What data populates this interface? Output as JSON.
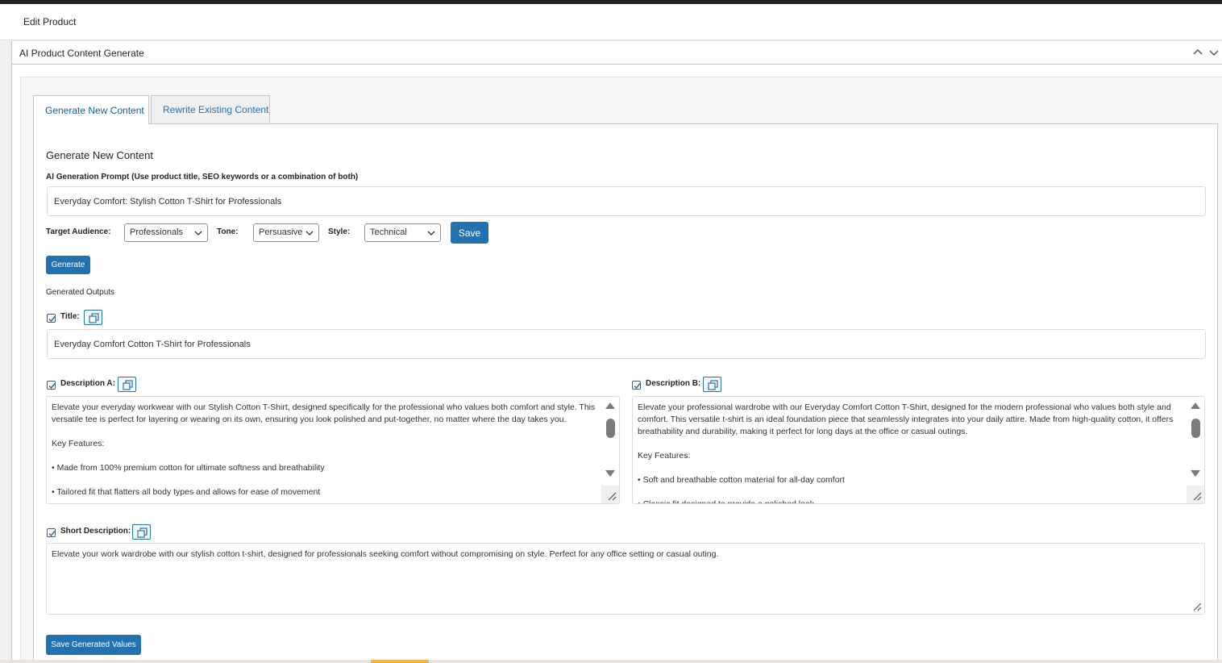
{
  "header": {
    "title": "Edit Product"
  },
  "postbox": {
    "title": "AI Product Content Generate"
  },
  "tabs": [
    {
      "label": "Generate New Content",
      "active": true
    },
    {
      "label": "Rewrite Existing Content",
      "active": false
    }
  ],
  "panel": {
    "heading": "Generate New Content",
    "prompt_label": "AI Generation Prompt (Use product title, SEO keywords or a combination of both)",
    "prompt_value": "Everyday Comfort: Stylish Cotton T-Shirt for Professionals",
    "target_audience_label": "Target Audience:",
    "target_audience_value": "Professionals",
    "tone_label": "Tone:",
    "tone_value": "Persuasive",
    "style_label": "Style:",
    "style_value": "Technical",
    "save_label": "Save",
    "generate_label": "Generate",
    "outputs_label": "Generated Outputs"
  },
  "outputs": {
    "title": {
      "label": "Title:",
      "checked": true,
      "value": "Everyday Comfort Cotton T-Shirt for Professionals"
    },
    "description_a": {
      "label": "Description A:",
      "checked": true,
      "value": "Elevate your everyday workwear with our Stylish Cotton T-Shirt, designed specifically for the professional who values both comfort and style. This versatile tee is perfect for layering or wearing on its own, ensuring you look polished and put-together, no matter where the day takes you.\n\nKey Features:\n\n• Made from 100% premium cotton for ultimate softness and breathability\n\n• Tailored fit that flatters all body types and allows for ease of movement"
    },
    "description_b": {
      "label": "Description B:",
      "checked": true,
      "value": "Elevate your professional wardrobe with our Everyday Comfort Cotton T-Shirt, designed for the modern professional who values both style and comfort. This versatile t-shirt is an ideal foundation piece that seamlessly integrates into your daily attire. Made from high-quality cotton, it offers breathability and durability, making it perfect for long days at the office or casual outings.\n\nKey Features:\n\n• Soft and breathable cotton material for all-day comfort\n\n• Classic fit designed to provide a polished look"
    },
    "short_description": {
      "label": "Short Description:",
      "checked": true,
      "value": "Elevate your work wardrobe with our stylish cotton t-shirt, designed for professionals seeking comfort without compromising on style. Perfect for any office setting or casual outing."
    }
  },
  "save_generated_label": "Save Generated Values",
  "colors": {
    "primary": "#2271b1",
    "border": "#c3c4c7",
    "text": "#1d2327"
  },
  "icons": [
    "chevron-up-icon",
    "chevron-down-icon",
    "copy-icon",
    "checkmark-icon",
    "resize-handle-icon"
  ]
}
